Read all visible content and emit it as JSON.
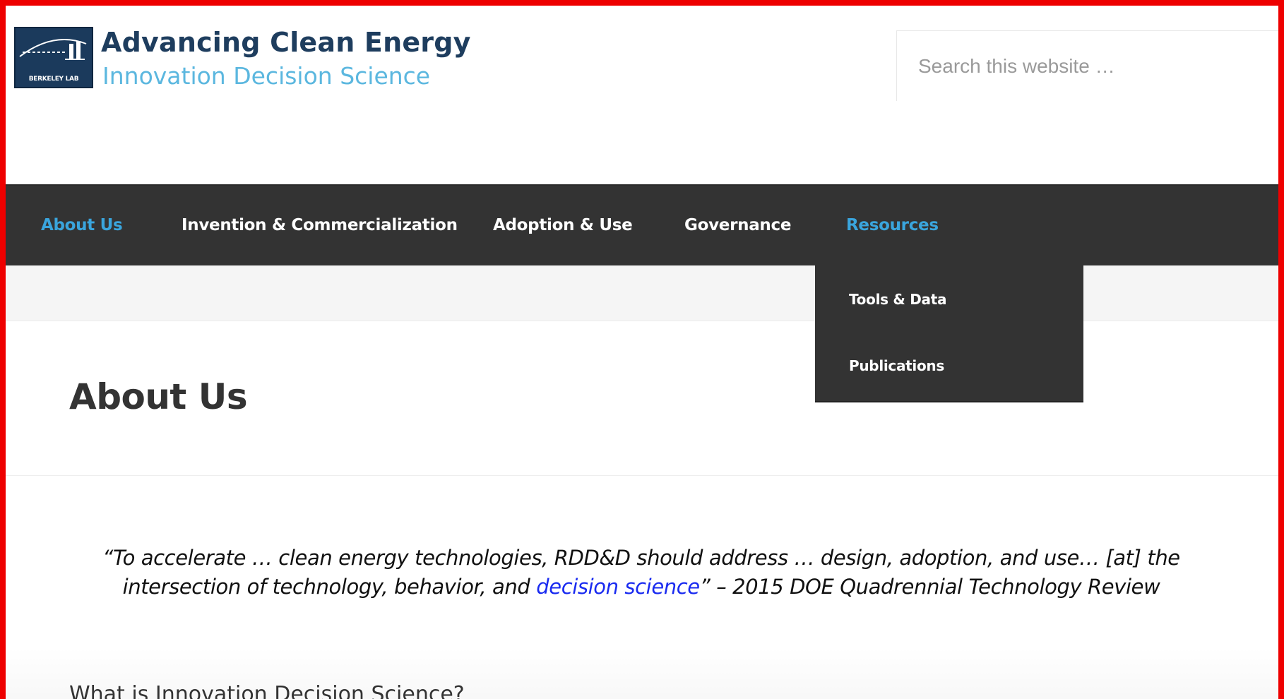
{
  "header": {
    "logo_text": "BERKELEY LAB",
    "title": "Advancing Clean Energy",
    "subtitle": "Innovation Decision Science"
  },
  "search": {
    "placeholder": "Search this website …"
  },
  "nav": {
    "items": [
      {
        "label": "About Us",
        "active": true
      },
      {
        "label": "Invention & Commercialization",
        "active": false
      },
      {
        "label": "Adoption & Use",
        "active": false
      },
      {
        "label": "Governance",
        "active": false
      },
      {
        "label": "Resources",
        "active": true
      }
    ],
    "dropdown": {
      "parent": "Resources",
      "items": [
        {
          "label": "Tools & Data"
        },
        {
          "label": "Publications"
        }
      ]
    }
  },
  "page": {
    "title": "About Us",
    "quote": {
      "text_before_link": "“To accelerate … clean energy technologies, RDD&D should address … design, adoption, and use… [at] the intersection of technology, behavior, and ",
      "link_text": "decision science",
      "text_after_link": "”",
      "attribution": "– 2015 DOE Quadrennial Technology Review"
    },
    "section_heading": "What is Innovation Decision Science?"
  },
  "colors": {
    "frame_border": "#ee0000",
    "title_navy": "#1e3d5e",
    "subtitle_blue": "#5bb7df",
    "nav_bg": "#333333",
    "nav_active": "#3aa5dd",
    "quote_link": "#1a2bf0"
  }
}
